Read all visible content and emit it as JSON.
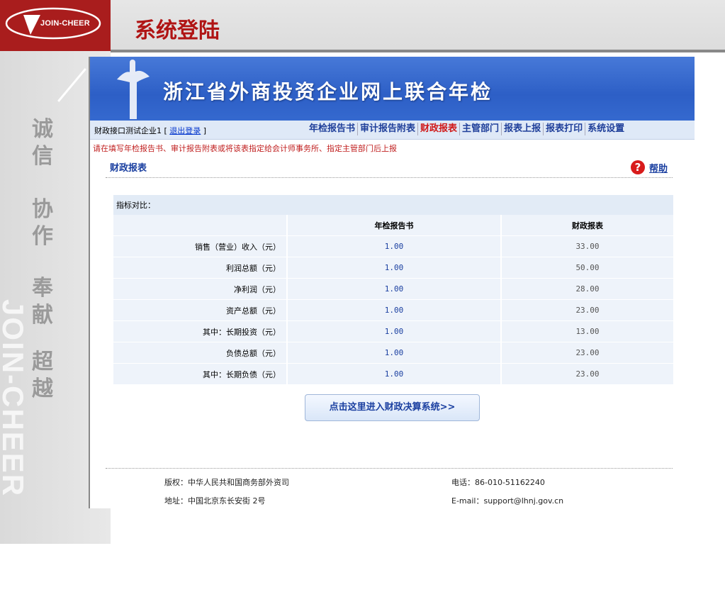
{
  "slide": {
    "logo_text": "JOIN-CHEER",
    "title": "系统登陆",
    "values": [
      "诚",
      "信",
      "协",
      "作",
      "奉",
      "献",
      "超",
      "越"
    ],
    "watermark": "JOIN-CHEER"
  },
  "app": {
    "banner_title": "浙江省外商投资企业网上联合年检",
    "user_prefix": "财政接口测试企业1 [",
    "logout_label": "退出登录",
    "user_suffix": "]",
    "nav": [
      "年检报告书",
      "审计报告附表",
      "财政报表",
      "主管部门",
      "报表上报",
      "报表打印",
      "系统设置"
    ],
    "active_nav": "财政报表",
    "notice": "请在填写年检报告书、审计报告附表或将该表指定给会计师事务所、指定主管部门后上报",
    "section_title": "财政报表",
    "help_label": "帮助"
  },
  "table": {
    "caption": "指标对比：",
    "columns": [
      "",
      "年检报告书",
      "财政报表"
    ],
    "rows": [
      {
        "label": "销售（营业）收入（元）",
        "report": "1.00",
        "finance": "33.00"
      },
      {
        "label": "利润总额（元）",
        "report": "1.00",
        "finance": "50.00"
      },
      {
        "label": "净利润（元）",
        "report": "1.00",
        "finance": "28.00"
      },
      {
        "label": "资产总额（元）",
        "report": "1.00",
        "finance": "23.00"
      },
      {
        "label": "其中：长期投资（元）",
        "report": "1.00",
        "finance": "13.00"
      },
      {
        "label": "负债总额（元）",
        "report": "1.00",
        "finance": "23.00"
      },
      {
        "label": "其中：长期负债（元）",
        "report": "1.00",
        "finance": "23.00"
      }
    ]
  },
  "enter_button": "点击这里进入财政决算系统>>",
  "footer": {
    "copyright": "版权：中华人民共和国商务部外资司",
    "phone": "电话：86-010-51162240",
    "address": "地址：中国北京东长安街 2号",
    "email": "E-mail：support@lhnj.gov.cn"
  },
  "colors": {
    "brand_red": "#a91d1d",
    "banner_blue": "#2d5fc6",
    "nav_blue": "#1f3f9a"
  }
}
